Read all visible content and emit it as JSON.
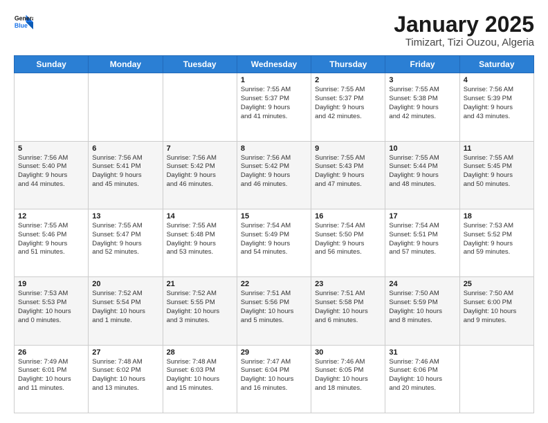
{
  "header": {
    "logo_line1": "General",
    "logo_line2": "Blue",
    "title": "January 2025",
    "subtitle": "Timizart, Tizi Ouzou, Algeria"
  },
  "weekdays": [
    "Sunday",
    "Monday",
    "Tuesday",
    "Wednesday",
    "Thursday",
    "Friday",
    "Saturday"
  ],
  "weeks": [
    [
      {
        "day": "",
        "detail": ""
      },
      {
        "day": "",
        "detail": ""
      },
      {
        "day": "",
        "detail": ""
      },
      {
        "day": "1",
        "detail": "Sunrise: 7:55 AM\nSunset: 5:37 PM\nDaylight: 9 hours\nand 41 minutes."
      },
      {
        "day": "2",
        "detail": "Sunrise: 7:55 AM\nSunset: 5:37 PM\nDaylight: 9 hours\nand 42 minutes."
      },
      {
        "day": "3",
        "detail": "Sunrise: 7:55 AM\nSunset: 5:38 PM\nDaylight: 9 hours\nand 42 minutes."
      },
      {
        "day": "4",
        "detail": "Sunrise: 7:56 AM\nSunset: 5:39 PM\nDaylight: 9 hours\nand 43 minutes."
      }
    ],
    [
      {
        "day": "5",
        "detail": "Sunrise: 7:56 AM\nSunset: 5:40 PM\nDaylight: 9 hours\nand 44 minutes."
      },
      {
        "day": "6",
        "detail": "Sunrise: 7:56 AM\nSunset: 5:41 PM\nDaylight: 9 hours\nand 45 minutes."
      },
      {
        "day": "7",
        "detail": "Sunrise: 7:56 AM\nSunset: 5:42 PM\nDaylight: 9 hours\nand 46 minutes."
      },
      {
        "day": "8",
        "detail": "Sunrise: 7:56 AM\nSunset: 5:42 PM\nDaylight: 9 hours\nand 46 minutes."
      },
      {
        "day": "9",
        "detail": "Sunrise: 7:55 AM\nSunset: 5:43 PM\nDaylight: 9 hours\nand 47 minutes."
      },
      {
        "day": "10",
        "detail": "Sunrise: 7:55 AM\nSunset: 5:44 PM\nDaylight: 9 hours\nand 48 minutes."
      },
      {
        "day": "11",
        "detail": "Sunrise: 7:55 AM\nSunset: 5:45 PM\nDaylight: 9 hours\nand 50 minutes."
      }
    ],
    [
      {
        "day": "12",
        "detail": "Sunrise: 7:55 AM\nSunset: 5:46 PM\nDaylight: 9 hours\nand 51 minutes."
      },
      {
        "day": "13",
        "detail": "Sunrise: 7:55 AM\nSunset: 5:47 PM\nDaylight: 9 hours\nand 52 minutes."
      },
      {
        "day": "14",
        "detail": "Sunrise: 7:55 AM\nSunset: 5:48 PM\nDaylight: 9 hours\nand 53 minutes."
      },
      {
        "day": "15",
        "detail": "Sunrise: 7:54 AM\nSunset: 5:49 PM\nDaylight: 9 hours\nand 54 minutes."
      },
      {
        "day": "16",
        "detail": "Sunrise: 7:54 AM\nSunset: 5:50 PM\nDaylight: 9 hours\nand 56 minutes."
      },
      {
        "day": "17",
        "detail": "Sunrise: 7:54 AM\nSunset: 5:51 PM\nDaylight: 9 hours\nand 57 minutes."
      },
      {
        "day": "18",
        "detail": "Sunrise: 7:53 AM\nSunset: 5:52 PM\nDaylight: 9 hours\nand 59 minutes."
      }
    ],
    [
      {
        "day": "19",
        "detail": "Sunrise: 7:53 AM\nSunset: 5:53 PM\nDaylight: 10 hours\nand 0 minutes."
      },
      {
        "day": "20",
        "detail": "Sunrise: 7:52 AM\nSunset: 5:54 PM\nDaylight: 10 hours\nand 1 minute."
      },
      {
        "day": "21",
        "detail": "Sunrise: 7:52 AM\nSunset: 5:55 PM\nDaylight: 10 hours\nand 3 minutes."
      },
      {
        "day": "22",
        "detail": "Sunrise: 7:51 AM\nSunset: 5:56 PM\nDaylight: 10 hours\nand 5 minutes."
      },
      {
        "day": "23",
        "detail": "Sunrise: 7:51 AM\nSunset: 5:58 PM\nDaylight: 10 hours\nand 6 minutes."
      },
      {
        "day": "24",
        "detail": "Sunrise: 7:50 AM\nSunset: 5:59 PM\nDaylight: 10 hours\nand 8 minutes."
      },
      {
        "day": "25",
        "detail": "Sunrise: 7:50 AM\nSunset: 6:00 PM\nDaylight: 10 hours\nand 9 minutes."
      }
    ],
    [
      {
        "day": "26",
        "detail": "Sunrise: 7:49 AM\nSunset: 6:01 PM\nDaylight: 10 hours\nand 11 minutes."
      },
      {
        "day": "27",
        "detail": "Sunrise: 7:48 AM\nSunset: 6:02 PM\nDaylight: 10 hours\nand 13 minutes."
      },
      {
        "day": "28",
        "detail": "Sunrise: 7:48 AM\nSunset: 6:03 PM\nDaylight: 10 hours\nand 15 minutes."
      },
      {
        "day": "29",
        "detail": "Sunrise: 7:47 AM\nSunset: 6:04 PM\nDaylight: 10 hours\nand 16 minutes."
      },
      {
        "day": "30",
        "detail": "Sunrise: 7:46 AM\nSunset: 6:05 PM\nDaylight: 10 hours\nand 18 minutes."
      },
      {
        "day": "31",
        "detail": "Sunrise: 7:46 AM\nSunset: 6:06 PM\nDaylight: 10 hours\nand 20 minutes."
      },
      {
        "day": "",
        "detail": ""
      }
    ]
  ]
}
